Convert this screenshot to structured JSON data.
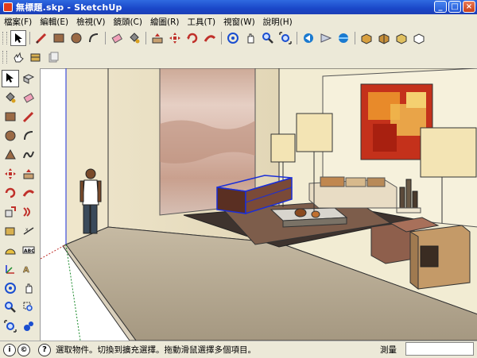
{
  "window": {
    "title": "無標題.skp - SketchUp",
    "minimize_label": "_",
    "maximize_label": "□",
    "close_label": "×"
  },
  "menu": [
    {
      "label": "檔案(F)"
    },
    {
      "label": "編輯(E)"
    },
    {
      "label": "檢視(V)"
    },
    {
      "label": "鏡頭(C)"
    },
    {
      "label": "繪圖(R)"
    },
    {
      "label": "工具(T)"
    },
    {
      "label": "視窗(W)"
    },
    {
      "label": "說明(H)"
    }
  ],
  "toolbar_icons": {
    "row1": [
      "select-icon",
      "pencil-line-icon",
      "rectangle-icon",
      "circle-icon",
      "arc-icon",
      "eraser-icon",
      "paint-bucket-icon",
      "push-pull-icon",
      "move-icon",
      "rotate-icon",
      "follow-me-icon",
      "orbit-icon",
      "pan-icon",
      "zoom-icon",
      "zoom-extents-icon",
      "previous-view-icon",
      "next-view-icon",
      "standard-views-icon",
      "shaded-style-icon",
      "x-ray-icon",
      "textured-icon",
      "wireframe-icon"
    ],
    "row2": [
      "hand-icon",
      "measure-tape-icon",
      "pages-icon"
    ]
  },
  "palette_icons": [
    "select-icon",
    "component-icon",
    "paint-bucket-icon",
    "eraser-icon",
    "rectangle-icon",
    "line-icon",
    "circle-icon",
    "arc-icon",
    "polygon-icon",
    "freehand-icon",
    "move-icon",
    "push-pull-icon",
    "rotate-icon",
    "follow-me-icon",
    "scale-icon",
    "offset-icon",
    "tape-measure-icon",
    "dimension-icon",
    "protractor-icon",
    "text-icon",
    "axes-icon",
    "3d-text-icon",
    "orbit-icon",
    "pan-icon",
    "zoom-icon",
    "zoom-window-icon",
    "zoom-extents-icon",
    "walk-icon"
  ],
  "status": {
    "message": "選取物件。切換到擴充選擇。拖動滑鼠選擇多個項目。",
    "measure_label": "測量",
    "measure_value": "",
    "help_label": "?",
    "geo_label": "i"
  },
  "colors": {
    "titlebar": "#2458d6",
    "chrome": "#ece9d8",
    "selection_blue": "#1a2ed8",
    "sky": "#ffffff",
    "floor": "#b8ab93"
  }
}
